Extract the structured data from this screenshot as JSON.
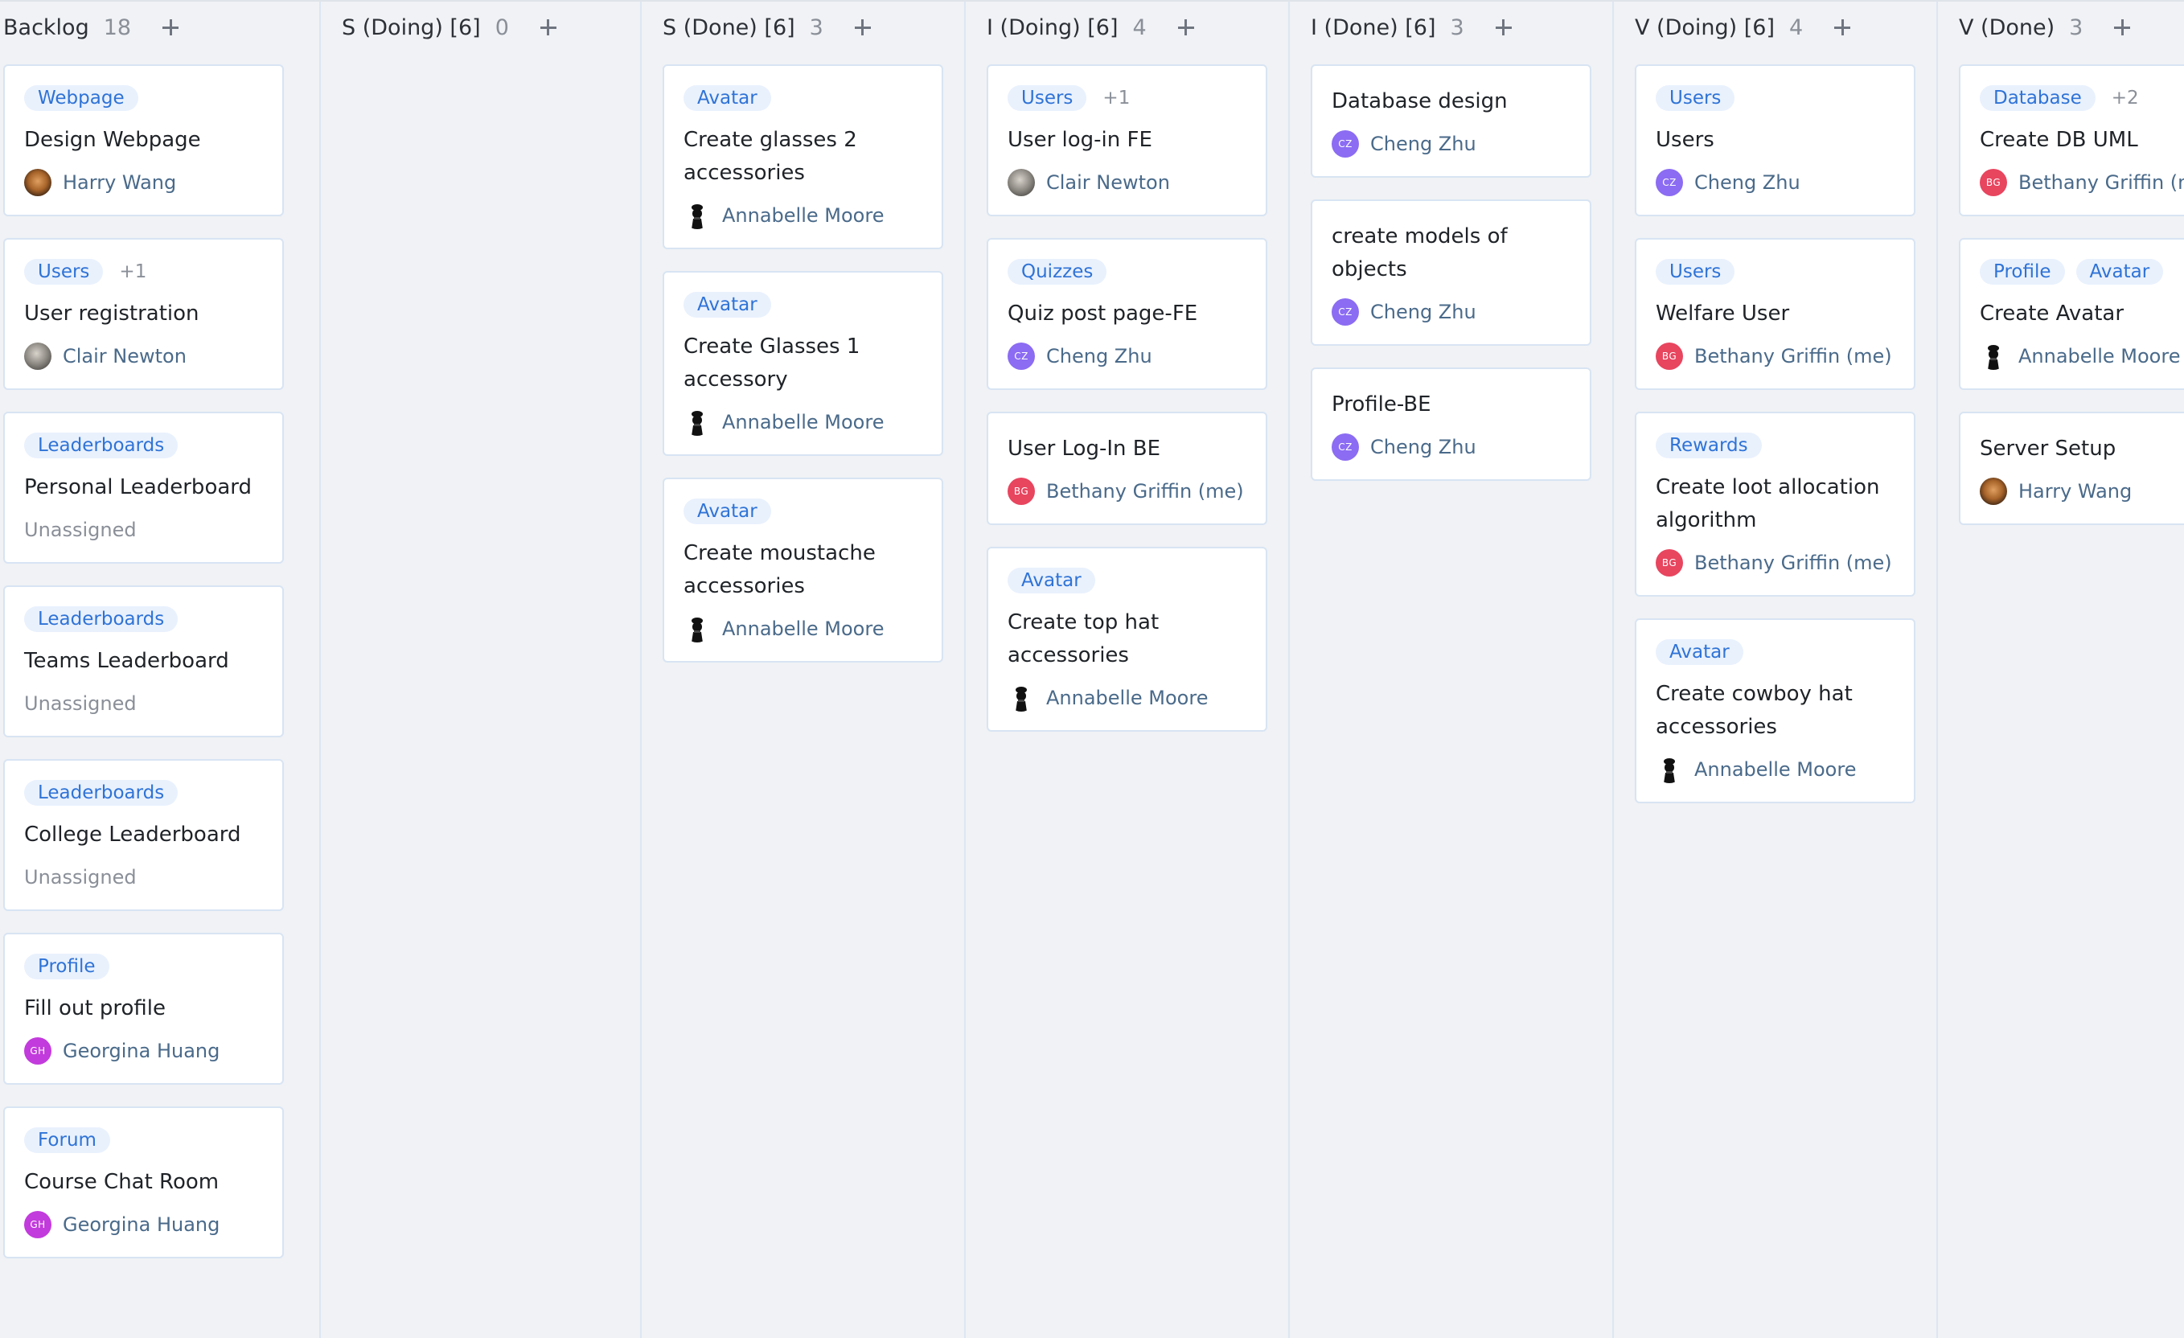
{
  "columns": [
    {
      "title": "Backlog",
      "count": "18",
      "cards": [
        {
          "tags": [
            "Webpage"
          ],
          "more": "",
          "title": "Design Webpage",
          "assignee": "Harry Wang",
          "avatar": "photo-brown"
        },
        {
          "tags": [
            "Users"
          ],
          "more": "+1",
          "title": "User registration",
          "assignee": "Clair Newton",
          "avatar": "photo-grey"
        },
        {
          "tags": [
            "Leaderboards"
          ],
          "more": "",
          "title": "Personal Leaderboard",
          "assignee": "Unassigned",
          "avatar": ""
        },
        {
          "tags": [
            "Leaderboards"
          ],
          "more": "",
          "title": "Teams Leaderboard",
          "assignee": "Unassigned",
          "avatar": ""
        },
        {
          "tags": [
            "Leaderboards"
          ],
          "more": "",
          "title": "College Leaderboard",
          "assignee": "Unassigned",
          "avatar": ""
        },
        {
          "tags": [
            "Profile"
          ],
          "more": "",
          "title": "Fill out profile",
          "assignee": "Georgina Huang",
          "avatar": "GH"
        },
        {
          "tags": [
            "Forum"
          ],
          "more": "",
          "title": "Course Chat Room",
          "assignee": "Georgina Huang",
          "avatar": "GH"
        }
      ]
    },
    {
      "title": "S (Doing) [6]",
      "count": "0",
      "cards": []
    },
    {
      "title": "S (Done) [6]",
      "count": "3",
      "cards": [
        {
          "tags": [
            "Avatar"
          ],
          "more": "",
          "title": "Create glasses 2 accessories",
          "assignee": "Annabelle Moore",
          "avatar": "silhouette"
        },
        {
          "tags": [
            "Avatar"
          ],
          "more": "",
          "title": "Create Glasses 1 accessory",
          "assignee": "Annabelle Moore",
          "avatar": "silhouette"
        },
        {
          "tags": [
            "Avatar"
          ],
          "more": "",
          "title": "Create moustache accessories",
          "assignee": "Annabelle Moore",
          "avatar": "silhouette"
        }
      ]
    },
    {
      "title": "I (Doing) [6]",
      "count": "4",
      "cards": [
        {
          "tags": [
            "Users"
          ],
          "more": "+1",
          "title": "User log-in FE",
          "assignee": "Clair Newton",
          "avatar": "photo-grey"
        },
        {
          "tags": [
            "Quizzes"
          ],
          "more": "",
          "title": "Quiz post page-FE",
          "assignee": "Cheng Zhu",
          "avatar": "CZ"
        },
        {
          "tags": [],
          "more": "",
          "title": "User Log-In BE",
          "assignee": "Bethany Griffin (me)",
          "avatar": "BG"
        },
        {
          "tags": [
            "Avatar"
          ],
          "more": "",
          "title": "Create top hat accessories",
          "assignee": "Annabelle Moore",
          "avatar": "silhouette"
        }
      ]
    },
    {
      "title": "I (Done) [6]",
      "count": "3",
      "cards": [
        {
          "tags": [],
          "more": "",
          "title": "Database design",
          "assignee": "Cheng Zhu",
          "avatar": "CZ"
        },
        {
          "tags": [],
          "more": "",
          "title": "create models of objects",
          "assignee": "Cheng Zhu",
          "avatar": "CZ"
        },
        {
          "tags": [],
          "more": "",
          "title": "Profile-BE",
          "assignee": "Cheng Zhu",
          "avatar": "CZ"
        }
      ]
    },
    {
      "title": "V (Doing) [6]",
      "count": "4",
      "cards": [
        {
          "tags": [
            "Users"
          ],
          "more": "",
          "title": "Users",
          "assignee": "Cheng Zhu",
          "avatar": "CZ"
        },
        {
          "tags": [
            "Users"
          ],
          "more": "",
          "title": "Welfare User",
          "assignee": "Bethany Griffin (me)",
          "avatar": "BG"
        },
        {
          "tags": [
            "Rewards"
          ],
          "more": "",
          "title": "Create loot allocation algorithm",
          "assignee": "Bethany Griffin (me)",
          "avatar": "BG"
        },
        {
          "tags": [
            "Avatar"
          ],
          "more": "",
          "title": "Create cowboy hat accessories",
          "assignee": "Annabelle Moore",
          "avatar": "silhouette"
        }
      ]
    },
    {
      "title": "V (Done)",
      "count": "3",
      "cards": [
        {
          "tags": [
            "Database"
          ],
          "more": "+2",
          "title": "Create DB UML",
          "assignee": "Bethany Griffin (me)",
          "avatar": "BG"
        },
        {
          "tags": [
            "Profile",
            "Avatar"
          ],
          "more": "",
          "title": "Create Avatar",
          "assignee": "Annabelle Moore",
          "avatar": "silhouette"
        },
        {
          "tags": [],
          "more": "",
          "title": "Server Setup",
          "assignee": "Harry Wang",
          "avatar": "photo-brown"
        }
      ]
    }
  ],
  "icons": {
    "add": "plus-icon"
  },
  "colors": {
    "tag_bg": "#e9f1fd",
    "tag_text": "#2f73d6",
    "cz": "#8b6cf2",
    "bg_avatar": "#e8455f",
    "gh": "#c23bdc"
  }
}
